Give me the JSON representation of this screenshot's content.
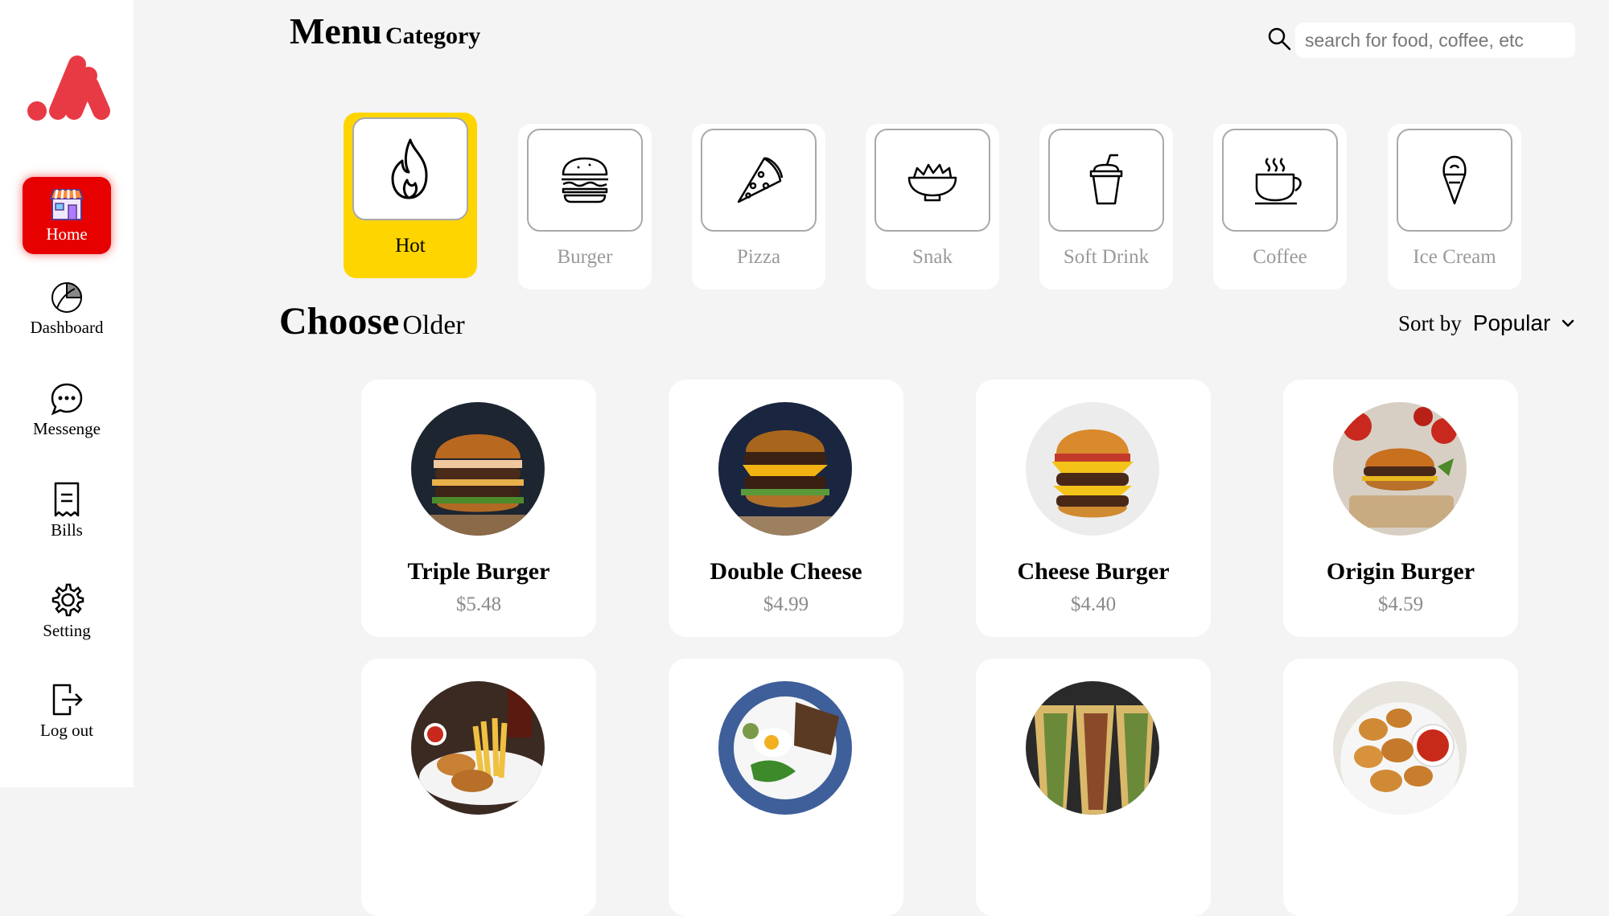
{
  "sidebar": {
    "logo": "brand-logo",
    "accent": "#e83a45",
    "items": [
      {
        "label": "Home",
        "icon": "store-icon",
        "active": true
      },
      {
        "label": "Dashboard",
        "icon": "pie-chart-icon"
      },
      {
        "label": "Messenge",
        "icon": "chat-bubble-icon"
      },
      {
        "label": "Bills",
        "icon": "receipt-icon"
      },
      {
        "label": "Setting",
        "icon": "gear-icon"
      },
      {
        "label": "Log out",
        "icon": "logout-icon"
      }
    ]
  },
  "header": {
    "title_main": "Menu",
    "title_sub": "Category",
    "search_placeholder": "search for food, coffee, etc"
  },
  "categories": [
    {
      "label": "Hot",
      "icon": "flame-icon",
      "active": true
    },
    {
      "label": "Burger",
      "icon": "burger-icon"
    },
    {
      "label": "Pizza",
      "icon": "pizza-slice-icon"
    },
    {
      "label": "Snak",
      "icon": "snack-bowl-icon"
    },
    {
      "label": "Soft Drink",
      "icon": "soft-drink-cup-icon"
    },
    {
      "label": "Coffee",
      "icon": "coffee-cup-icon"
    },
    {
      "label": "Ice Cream",
      "icon": "ice-cream-cone-icon"
    }
  ],
  "section": {
    "title_main": "Choose",
    "title_sub": "Older",
    "sort_label": "Sort by",
    "sort_value": "Popular"
  },
  "products": [
    {
      "name": "Triple Burger",
      "price": "$5.48"
    },
    {
      "name": "Double Cheese",
      "price": "$4.99"
    },
    {
      "name": "Cheese Burger",
      "price": "$4.40"
    },
    {
      "name": "Origin Burger",
      "price": "$4.59"
    },
    {
      "name": "",
      "price": ""
    },
    {
      "name": "",
      "price": ""
    },
    {
      "name": "",
      "price": ""
    },
    {
      "name": "",
      "price": ""
    }
  ],
  "colors": {
    "active_nav": "#e60000",
    "active_category": "#ffd500",
    "background": "#f4f4f4"
  }
}
